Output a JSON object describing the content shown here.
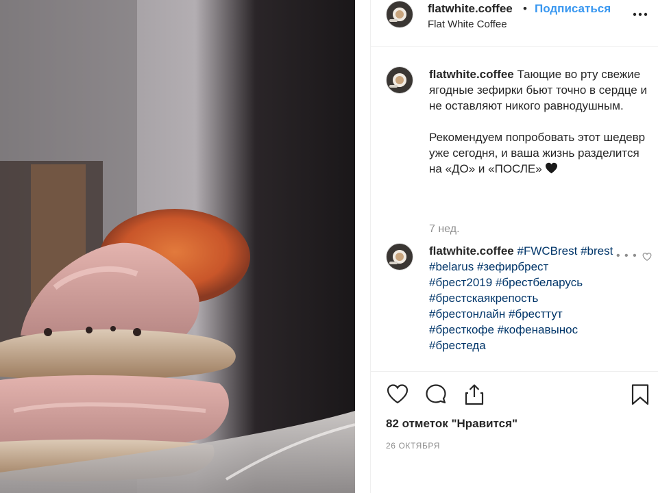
{
  "header": {
    "username": "flatwhite.coffee",
    "separator": "•",
    "follow_label": "Подписаться",
    "subtitle": "Flat White Coffee",
    "more_icon": "more-horizontal-icon"
  },
  "caption": {
    "username": "flatwhite.coffee",
    "paragraph1": "Тающие во рту свежие ягодные зефирки бьют точно в сердце и не оставляют никого равнодушным.",
    "paragraph2": "Рекомендуем попробовать этот шедевр уже сегодня, и ваша жизнь разделится на «ДО» и «ПОСЛЕ»",
    "emoji": "black-heart-emoji",
    "time": "7 нед."
  },
  "comment": {
    "username": "flatwhite.coffee",
    "tags": [
      "#FWCBrest",
      "#brest",
      "#belarus",
      "#зефирбрест",
      "#брест2019",
      "#брестбеларусь",
      "#брестскаякрепость",
      "#брестонлайн",
      "#бресттут",
      "#бресткофе",
      "#кофенавынос",
      "#брестеда"
    ],
    "more_label": "• • •"
  },
  "actions": {
    "like_icon": "heart-outline-icon",
    "comment_icon": "comment-bubble-icon",
    "share_icon": "share-upload-icon",
    "save_icon": "bookmark-icon"
  },
  "likes_text": "82 отметок \"Нравится\"",
  "date_text": "26 ОКТЯБРЯ",
  "colors": {
    "accent": "#3897f0",
    "hashtag": "#003569",
    "muted": "#8e8e8e",
    "text": "#262626"
  }
}
